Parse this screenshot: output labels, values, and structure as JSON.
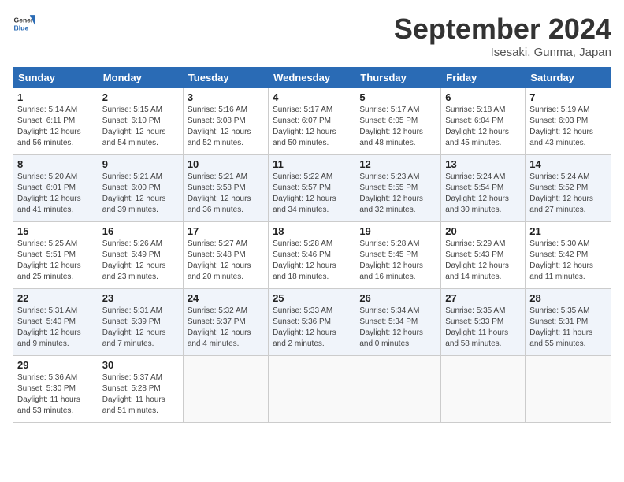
{
  "header": {
    "logo_general": "General",
    "logo_blue": "Blue",
    "month": "September 2024",
    "location": "Isesaki, Gunma, Japan"
  },
  "weekdays": [
    "Sunday",
    "Monday",
    "Tuesday",
    "Wednesday",
    "Thursday",
    "Friday",
    "Saturday"
  ],
  "weeks": [
    [
      {
        "day": "1",
        "info": "Sunrise: 5:14 AM\nSunset: 6:11 PM\nDaylight: 12 hours\nand 56 minutes."
      },
      {
        "day": "2",
        "info": "Sunrise: 5:15 AM\nSunset: 6:10 PM\nDaylight: 12 hours\nand 54 minutes."
      },
      {
        "day": "3",
        "info": "Sunrise: 5:16 AM\nSunset: 6:08 PM\nDaylight: 12 hours\nand 52 minutes."
      },
      {
        "day": "4",
        "info": "Sunrise: 5:17 AM\nSunset: 6:07 PM\nDaylight: 12 hours\nand 50 minutes."
      },
      {
        "day": "5",
        "info": "Sunrise: 5:17 AM\nSunset: 6:05 PM\nDaylight: 12 hours\nand 48 minutes."
      },
      {
        "day": "6",
        "info": "Sunrise: 5:18 AM\nSunset: 6:04 PM\nDaylight: 12 hours\nand 45 minutes."
      },
      {
        "day": "7",
        "info": "Sunrise: 5:19 AM\nSunset: 6:03 PM\nDaylight: 12 hours\nand 43 minutes."
      }
    ],
    [
      {
        "day": "8",
        "info": "Sunrise: 5:20 AM\nSunset: 6:01 PM\nDaylight: 12 hours\nand 41 minutes."
      },
      {
        "day": "9",
        "info": "Sunrise: 5:21 AM\nSunset: 6:00 PM\nDaylight: 12 hours\nand 39 minutes."
      },
      {
        "day": "10",
        "info": "Sunrise: 5:21 AM\nSunset: 5:58 PM\nDaylight: 12 hours\nand 36 minutes."
      },
      {
        "day": "11",
        "info": "Sunrise: 5:22 AM\nSunset: 5:57 PM\nDaylight: 12 hours\nand 34 minutes."
      },
      {
        "day": "12",
        "info": "Sunrise: 5:23 AM\nSunset: 5:55 PM\nDaylight: 12 hours\nand 32 minutes."
      },
      {
        "day": "13",
        "info": "Sunrise: 5:24 AM\nSunset: 5:54 PM\nDaylight: 12 hours\nand 30 minutes."
      },
      {
        "day": "14",
        "info": "Sunrise: 5:24 AM\nSunset: 5:52 PM\nDaylight: 12 hours\nand 27 minutes."
      }
    ],
    [
      {
        "day": "15",
        "info": "Sunrise: 5:25 AM\nSunset: 5:51 PM\nDaylight: 12 hours\nand 25 minutes."
      },
      {
        "day": "16",
        "info": "Sunrise: 5:26 AM\nSunset: 5:49 PM\nDaylight: 12 hours\nand 23 minutes."
      },
      {
        "day": "17",
        "info": "Sunrise: 5:27 AM\nSunset: 5:48 PM\nDaylight: 12 hours\nand 20 minutes."
      },
      {
        "day": "18",
        "info": "Sunrise: 5:28 AM\nSunset: 5:46 PM\nDaylight: 12 hours\nand 18 minutes."
      },
      {
        "day": "19",
        "info": "Sunrise: 5:28 AM\nSunset: 5:45 PM\nDaylight: 12 hours\nand 16 minutes."
      },
      {
        "day": "20",
        "info": "Sunrise: 5:29 AM\nSunset: 5:43 PM\nDaylight: 12 hours\nand 14 minutes."
      },
      {
        "day": "21",
        "info": "Sunrise: 5:30 AM\nSunset: 5:42 PM\nDaylight: 12 hours\nand 11 minutes."
      }
    ],
    [
      {
        "day": "22",
        "info": "Sunrise: 5:31 AM\nSunset: 5:40 PM\nDaylight: 12 hours\nand 9 minutes."
      },
      {
        "day": "23",
        "info": "Sunrise: 5:31 AM\nSunset: 5:39 PM\nDaylight: 12 hours\nand 7 minutes."
      },
      {
        "day": "24",
        "info": "Sunrise: 5:32 AM\nSunset: 5:37 PM\nDaylight: 12 hours\nand 4 minutes."
      },
      {
        "day": "25",
        "info": "Sunrise: 5:33 AM\nSunset: 5:36 PM\nDaylight: 12 hours\nand 2 minutes."
      },
      {
        "day": "26",
        "info": "Sunrise: 5:34 AM\nSunset: 5:34 PM\nDaylight: 12 hours\nand 0 minutes."
      },
      {
        "day": "27",
        "info": "Sunrise: 5:35 AM\nSunset: 5:33 PM\nDaylight: 11 hours\nand 58 minutes."
      },
      {
        "day": "28",
        "info": "Sunrise: 5:35 AM\nSunset: 5:31 PM\nDaylight: 11 hours\nand 55 minutes."
      }
    ],
    [
      {
        "day": "29",
        "info": "Sunrise: 5:36 AM\nSunset: 5:30 PM\nDaylight: 11 hours\nand 53 minutes."
      },
      {
        "day": "30",
        "info": "Sunrise: 5:37 AM\nSunset: 5:28 PM\nDaylight: 11 hours\nand 51 minutes."
      },
      {
        "day": "",
        "info": ""
      },
      {
        "day": "",
        "info": ""
      },
      {
        "day": "",
        "info": ""
      },
      {
        "day": "",
        "info": ""
      },
      {
        "day": "",
        "info": ""
      }
    ]
  ]
}
